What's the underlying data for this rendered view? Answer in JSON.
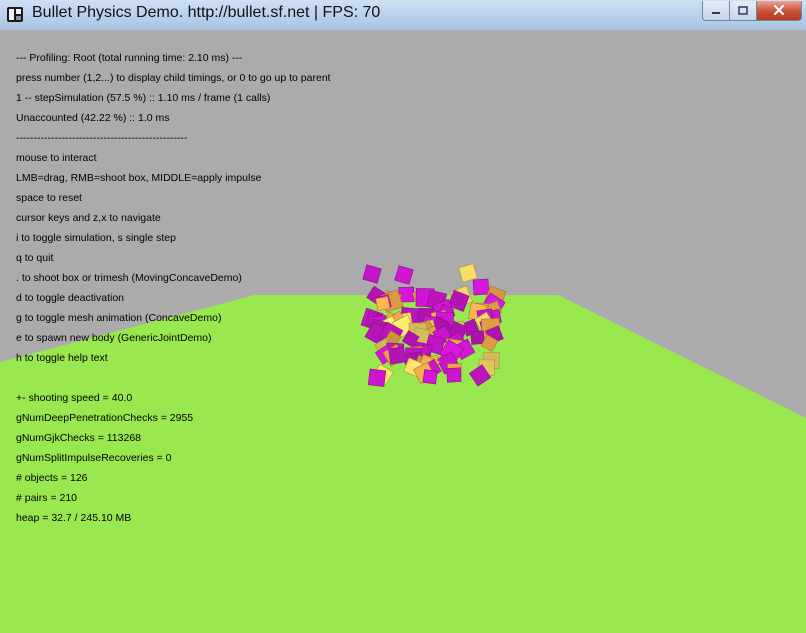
{
  "window": {
    "title": "Bullet Physics Demo. http://bullet.sf.net | FPS: 70",
    "icons": {
      "app": "bullet-app-icon",
      "minimize": "minimize-icon",
      "maximize": "maximize-icon",
      "close": "close-icon"
    }
  },
  "colors": {
    "background": "#ababab",
    "ground": "#99e84f",
    "box_magenta": "#d416d6",
    "box_orange": "#ffb24e",
    "box_yellow": "#ffe36a"
  },
  "hud": {
    "profiling": [
      "--- Profiling: Root (total running time: 2.10 ms) ---",
      "press number (1,2...) to display child timings, or 0 to go up to parent",
      "1 -- stepSimulation (57.5 %) :: 1.10 ms / frame (1 calls)",
      "Unaccounted (42.22 %) :: 1.0 ms",
      "-------------------------------------------------"
    ],
    "help": [
      "mouse to interact",
      "LMB=drag, RMB=shoot box, MIDDLE=apply impulse",
      "space to reset",
      "cursor keys and z,x to navigate",
      "i to toggle simulation, s single step",
      "q to quit",
      ". to shoot box or trimesh (MovingConcaveDemo)",
      "d to toggle deactivation",
      "g to toggle mesh animation (ConcaveDemo)",
      "e to spawn new body (GenericJointDemo)",
      "h to toggle help text"
    ],
    "stats": [
      "+- shooting speed = 40.0",
      "gNumDeepPenetrationChecks = 2955",
      "gNumGjkChecks = 113268",
      "gNumSplitImpulseRecoveries = 0",
      "# objects = 126",
      "# pairs = 210",
      "heap = 32.7 / 245.10 MB"
    ]
  }
}
